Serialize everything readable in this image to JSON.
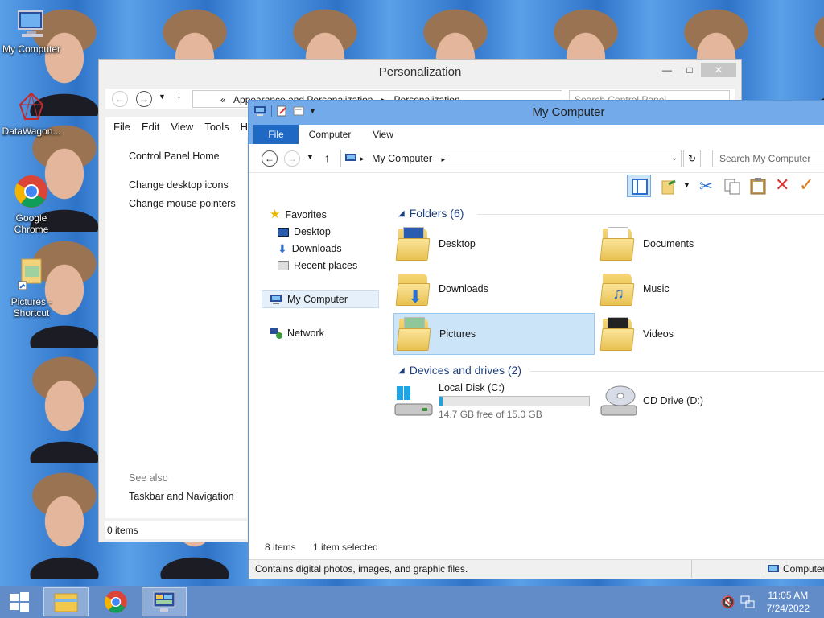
{
  "desktop": {
    "icons": [
      {
        "label": "My Computer"
      },
      {
        "label": "DataWagon..."
      },
      {
        "label": "Google Chrome"
      },
      {
        "label": "Pictures - Shortcut"
      }
    ]
  },
  "personalization": {
    "title": "Personalization",
    "breadcrumb": [
      "Appearance and Personalization",
      "Personalization"
    ],
    "search_placeholder": "Search Control Panel",
    "menu": [
      "File",
      "Edit",
      "View",
      "Tools",
      "H"
    ],
    "links": {
      "home": "Control Panel Home",
      "desktop_icons": "Change desktop icons",
      "mouse_pointers": "Change mouse pointers"
    },
    "see_also_label": "See also",
    "see_also_link": "Taskbar and Navigation",
    "status": "0 items"
  },
  "mycomputer": {
    "title": "My Computer",
    "tabs": {
      "file": "File",
      "computer": "Computer",
      "view": "View"
    },
    "address": "My Computer",
    "search_placeholder": "Search My Computer",
    "nav": {
      "favorites": "Favorites",
      "desktop": "Desktop",
      "downloads": "Downloads",
      "recent": "Recent places",
      "mycomputer": "My Computer",
      "network": "Network"
    },
    "folders_header": "Folders (6)",
    "folders": [
      {
        "label": "Desktop"
      },
      {
        "label": "Documents"
      },
      {
        "label": "Downloads"
      },
      {
        "label": "Music"
      },
      {
        "label": "Pictures"
      },
      {
        "label": "Videos"
      }
    ],
    "devices_header": "Devices and drives (2)",
    "drives": {
      "c_label": "Local Disk (C:)",
      "c_free": "14.7 GB free of 15.0 GB",
      "c_used_fraction": 0.02,
      "d_label": "CD Drive (D:)"
    },
    "status": {
      "count": "8 items",
      "selected": "1 item selected"
    },
    "info": "Contains digital photos, images, and graphic files.",
    "info_right": "Computer"
  },
  "taskbar": {
    "time": "11:05 AM",
    "date": "7/24/2022"
  },
  "colors": {
    "accent": "#1f69c4",
    "frame": "#73aaea",
    "selection": "#cce4f7"
  }
}
